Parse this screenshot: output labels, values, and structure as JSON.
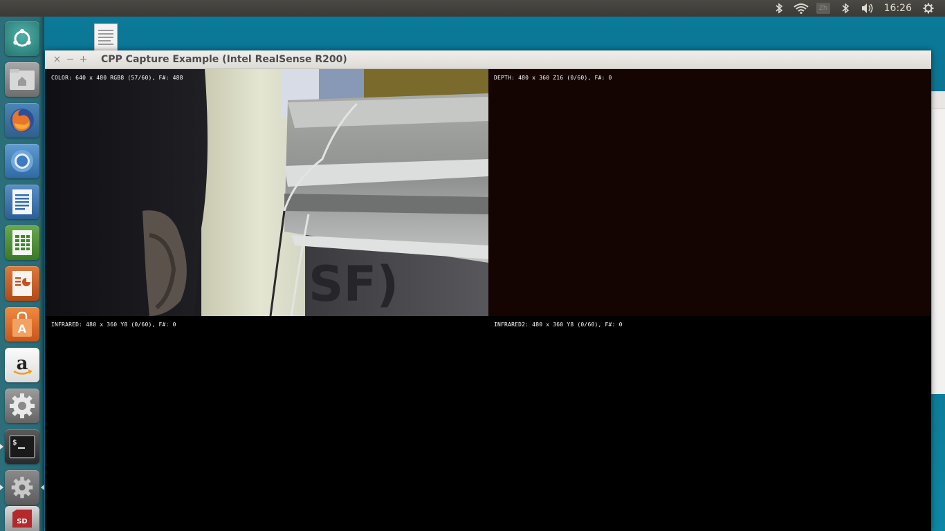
{
  "top_panel": {
    "clock": "16:26",
    "keyboard_indicator": "Zh"
  },
  "window": {
    "title": "CPP Capture Example (Intel RealSense R200)",
    "close_glyph": "×",
    "minimize_glyph": "−",
    "maximize_glyph": "+"
  },
  "streams": {
    "color": {
      "label": "COLOR: 640 x 480 RGB8 (57/60), F#: 488",
      "bg": "#1a1a1e"
    },
    "depth": {
      "label": "DEPTH: 480 x 360 Z16 (0/60), F#: 0",
      "bg": "#140402"
    },
    "infrared": {
      "label": "INFRARED: 480 x 360 Y8 (0/60), F#: 0",
      "bg": "#000000"
    },
    "infrared2": {
      "label": "INFRARED2: 480 x 360 Y8 (0/60), F#: 0",
      "bg": "#000000"
    }
  },
  "launcher": {
    "items": [
      {
        "name": "dash-home",
        "icon": "ubuntu-logo-icon",
        "color": "#3a8f8a"
      },
      {
        "name": "files",
        "icon": "home-folder-icon",
        "color": "#8c8c8c"
      },
      {
        "name": "firefox",
        "icon": "firefox-icon",
        "color": "#d65b1f"
      },
      {
        "name": "chromium",
        "icon": "chromium-icon",
        "color": "#3e7fc1"
      },
      {
        "name": "libreoffice-writer",
        "icon": "writer-document-icon",
        "color": "#2f6fb0"
      },
      {
        "name": "libreoffice-calc",
        "icon": "calc-spreadsheet-icon",
        "color": "#3d8a2c"
      },
      {
        "name": "libreoffice-impress",
        "icon": "impress-presentation-icon",
        "color": "#c9501c"
      },
      {
        "name": "software-center",
        "icon": "shopping-bag-icon",
        "color": "#e06a2a"
      },
      {
        "name": "amazon",
        "icon": "amazon-logo-icon",
        "color": "#f0f0f0"
      },
      {
        "name": "system-settings",
        "icon": "gear-icon",
        "color": "#7a7a7a"
      },
      {
        "name": "terminal",
        "icon": "terminal-icon",
        "color": "#2b2b2b"
      },
      {
        "name": "capture-example",
        "icon": "gear-icon",
        "color": "#6f6f6f"
      },
      {
        "name": "sd-card",
        "icon": "sd-card-icon",
        "color": "#b5282c"
      }
    ]
  },
  "tray_icons": [
    "bluetooth-icon",
    "wifi-icon",
    "keyboard-icon",
    "bluetooth-icon",
    "volume-icon",
    "clock",
    "power-gear-icon"
  ]
}
